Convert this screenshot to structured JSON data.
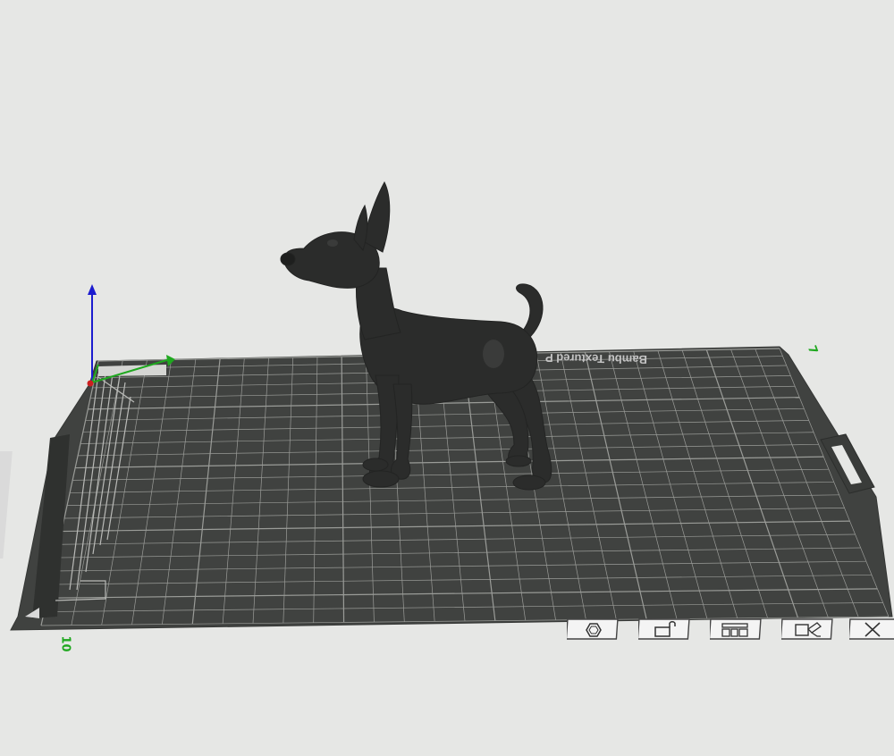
{
  "viewport": {
    "background": "#e6e7e5",
    "bed_color": "#404240",
    "grid_color": "#9a9c98",
    "model_color": "#2b2c2b"
  },
  "bed": {
    "label": "Bambu Textured P",
    "origin_label": "10",
    "right_marker": "7"
  },
  "plate_controls": [
    {
      "id": "orient",
      "icon": "hexagon-icon"
    },
    {
      "id": "lock",
      "icon": "lock-icon"
    },
    {
      "id": "arrange",
      "icon": "arrange-icon"
    },
    {
      "id": "settings",
      "icon": "edit-plate-icon"
    },
    {
      "id": "delete",
      "icon": "close-icon"
    }
  ]
}
